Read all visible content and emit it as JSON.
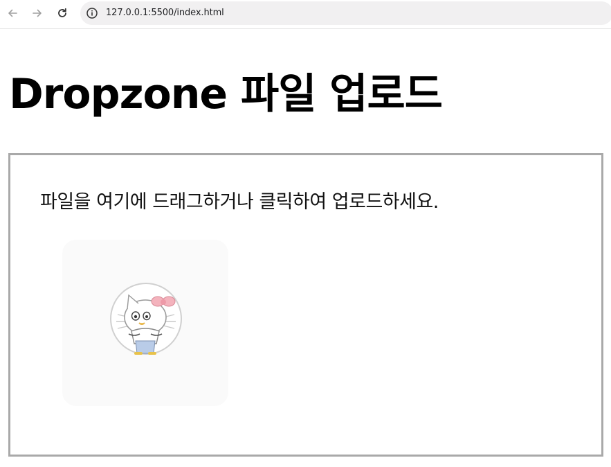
{
  "browser": {
    "url": "127.0.0.1:5500/index.html",
    "back_icon": "arrow-left-icon",
    "forward_icon": "arrow-right-icon",
    "reload_icon": "reload-icon",
    "site_info_icon": "info-icon"
  },
  "page": {
    "title": "Dropzone 파일 업로드"
  },
  "dropzone": {
    "message": "파일을 여기에 드래그하거나 클릭하여 업로드하세요.",
    "border_color": "#a9a9a9",
    "preview": {
      "thumbnail": "hello-kitty-thumbnail"
    }
  }
}
